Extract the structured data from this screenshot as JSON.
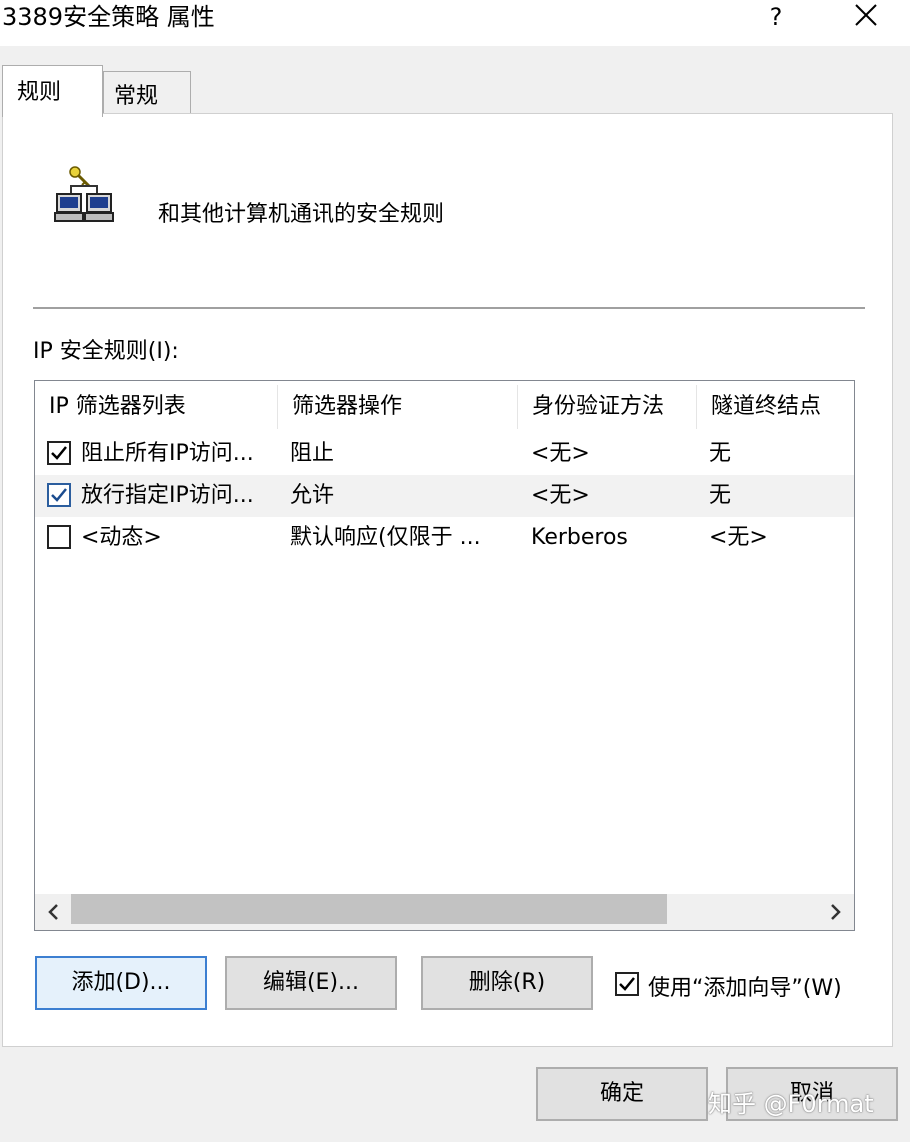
{
  "window": {
    "title": "3389安全策略 属性",
    "help": "?"
  },
  "tabs": [
    {
      "label": "规则",
      "active": true
    },
    {
      "label": "常规",
      "active": false
    }
  ],
  "header": {
    "icon": "network-computers-key-icon",
    "description": "和其他计算机通讯的安全规则"
  },
  "rules_list": {
    "label": "IP 安全规则(I):",
    "columns": [
      "IP 筛选器列表",
      "筛选器操作",
      "身份验证方法",
      "隧道终结点"
    ],
    "rows": [
      {
        "checked": true,
        "filter_list": "阻止所有IP访问...",
        "filter_action": "阻止",
        "auth_method": "<无>",
        "tunnel_endpoint": "无"
      },
      {
        "checked": true,
        "filter_list": "放行指定IP访问...",
        "filter_action": "允许",
        "auth_method": "<无>",
        "tunnel_endpoint": "无"
      },
      {
        "checked": false,
        "filter_list": "<动态>",
        "filter_action": "默认响应(仅限于 ...",
        "auth_method": "Kerberos",
        "tunnel_endpoint": "<无>"
      }
    ]
  },
  "buttons": {
    "add": "添加(D)...",
    "edit": "编辑(E)...",
    "delete": "删除(R)",
    "ok": "确定",
    "cancel": "取消"
  },
  "wizard": {
    "label": "使用“添加向导”(W)",
    "checked": true
  },
  "watermark": "知乎 @F0rmat",
  "colors": {
    "accent": "#3c7fd1",
    "button_face": "#e1e1e1",
    "scroll_thumb": "#c2c2c2"
  }
}
